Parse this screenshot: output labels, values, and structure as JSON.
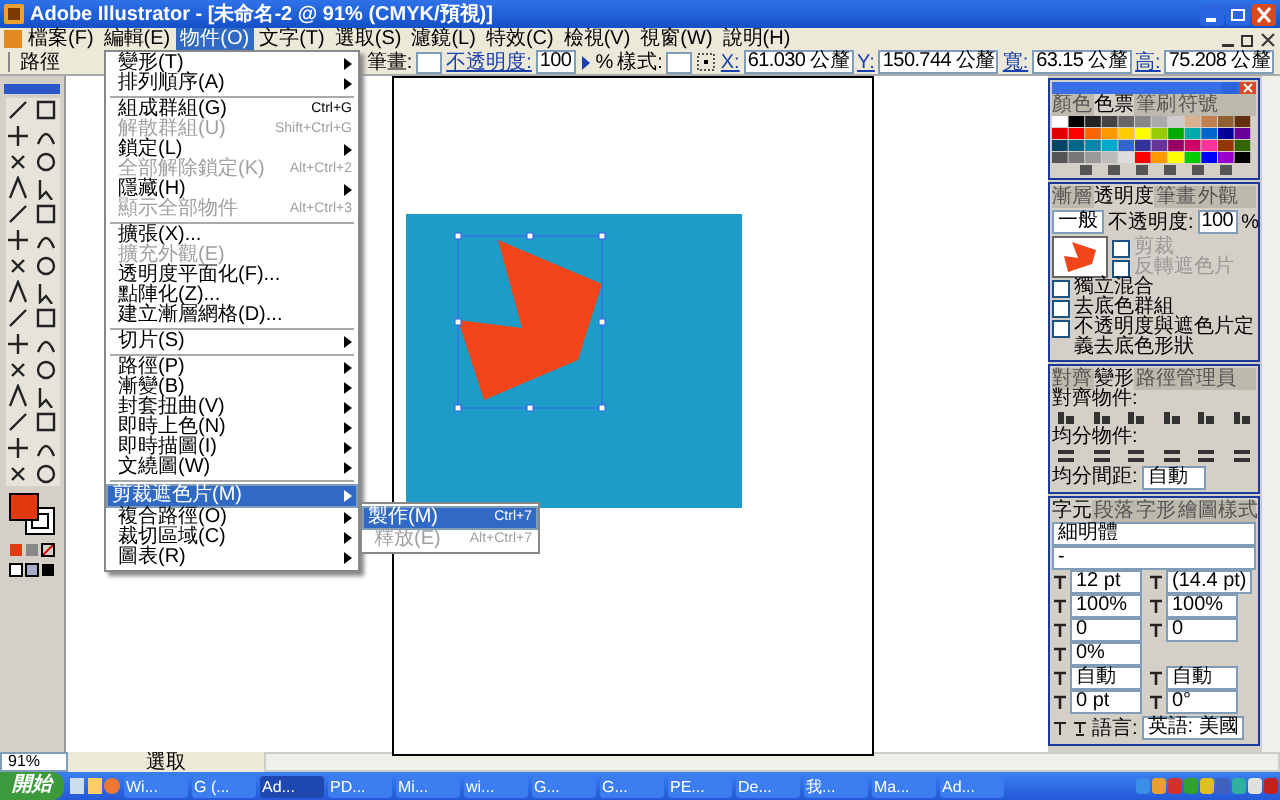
{
  "window": {
    "title": "Adobe Illustrator - [未命名-2 @ 91% (CMYK/預視)]"
  },
  "menu_bar": [
    {
      "label": "檔案(F)",
      "selected": false
    },
    {
      "label": "編輯(E)",
      "selected": false
    },
    {
      "label": "物件(O)",
      "selected": true
    },
    {
      "label": "文字(T)",
      "selected": false
    },
    {
      "label": "選取(S)",
      "selected": false
    },
    {
      "label": "濾鏡(L)",
      "selected": false
    },
    {
      "label": "特效(C)",
      "selected": false
    },
    {
      "label": "檢視(V)",
      "selected": false
    },
    {
      "label": "視窗(W)",
      "selected": false
    },
    {
      "label": "說明(H)",
      "selected": false
    }
  ],
  "control_bar": {
    "object_type": "路徑",
    "stroke_label": "筆畫:",
    "opacity_label": "不透明度:",
    "opacity": "100",
    "percent": "%",
    "style_label": "樣式:",
    "fields": [
      {
        "label": "X:",
        "value": "61.030 公釐"
      },
      {
        "label": "Y:",
        "value": "150.744 公釐"
      },
      {
        "label": "寬:",
        "value": "63.15 公釐"
      },
      {
        "label": "高:",
        "value": "75.208 公釐"
      }
    ]
  },
  "object_menu": {
    "items": [
      {
        "kind": "item",
        "label": "變形(T)",
        "submenu": true,
        "disabled": false,
        "selected": false
      },
      {
        "kind": "item",
        "label": "排列順序(A)",
        "submenu": true,
        "disabled": false,
        "selected": false
      },
      {
        "kind": "separator"
      },
      {
        "kind": "item",
        "label": "組成群組(G)",
        "shortcut": "Ctrl+G",
        "submenu": false,
        "disabled": false,
        "selected": false
      },
      {
        "kind": "item",
        "label": "解散群組(U)",
        "shortcut": "Shift+Ctrl+G",
        "submenu": false,
        "disabled": true,
        "selected": false
      },
      {
        "kind": "item",
        "label": "鎖定(L)",
        "submenu": true,
        "disabled": false,
        "selected": false
      },
      {
        "kind": "item",
        "label": "全部解除鎖定(K)",
        "shortcut": "Alt+Ctrl+2",
        "submenu": false,
        "disabled": true,
        "selected": false
      },
      {
        "kind": "item",
        "label": "隱藏(H)",
        "submenu": true,
        "disabled": false,
        "selected": false
      },
      {
        "kind": "item",
        "label": "顯示全部物件",
        "shortcut": "Alt+Ctrl+3",
        "submenu": false,
        "disabled": true,
        "selected": false
      },
      {
        "kind": "separator"
      },
      {
        "kind": "item",
        "label": "擴張(X)...",
        "submenu": false,
        "disabled": false,
        "selected": false
      },
      {
        "kind": "item",
        "label": "擴充外觀(E)",
        "submenu": false,
        "disabled": true,
        "selected": false
      },
      {
        "kind": "item",
        "label": "透明度平面化(F)...",
        "submenu": false,
        "disabled": false,
        "selected": false
      },
      {
        "kind": "item",
        "label": "點陣化(Z)...",
        "submenu": false,
        "disabled": false,
        "selected": false
      },
      {
        "kind": "item",
        "label": "建立漸層網格(D)...",
        "submenu": false,
        "disabled": false,
        "selected": false
      },
      {
        "kind": "separator"
      },
      {
        "kind": "item",
        "label": "切片(S)",
        "submenu": true,
        "disabled": false,
        "selected": false
      },
      {
        "kind": "separator"
      },
      {
        "kind": "item",
        "label": "路徑(P)",
        "submenu": true,
        "disabled": false,
        "selected": false
      },
      {
        "kind": "item",
        "label": "漸變(B)",
        "submenu": true,
        "disabled": false,
        "selected": false
      },
      {
        "kind": "item",
        "label": "封套扭曲(V)",
        "submenu": true,
        "disabled": false,
        "selected": false
      },
      {
        "kind": "item",
        "label": "即時上色(N)",
        "submenu": true,
        "disabled": false,
        "selected": false
      },
      {
        "kind": "item",
        "label": "即時描圖(I)",
        "submenu": true,
        "disabled": false,
        "selected": false
      },
      {
        "kind": "item",
        "label": "文繞圖(W)",
        "submenu": true,
        "disabled": false,
        "selected": false
      },
      {
        "kind": "separator"
      },
      {
        "kind": "item",
        "label": "剪裁遮色片(M)",
        "submenu": true,
        "disabled": false,
        "selected": true
      },
      {
        "kind": "item",
        "label": "複合路徑(O)",
        "submenu": true,
        "disabled": false,
        "selected": false
      },
      {
        "kind": "item",
        "label": "裁切區域(C)",
        "submenu": true,
        "disabled": false,
        "selected": false
      },
      {
        "kind": "item",
        "label": "圖表(R)",
        "submenu": true,
        "disabled": false,
        "selected": false
      }
    ]
  },
  "submenu": {
    "items": [
      {
        "label": "製作(M)",
        "shortcut": "Ctrl+7",
        "disabled": false,
        "selected": true
      },
      {
        "label": "釋放(E)",
        "shortcut": "Alt+Ctrl+7",
        "disabled": true,
        "selected": false
      }
    ]
  },
  "color_panel": {
    "tabs": [
      {
        "label": "顏色",
        "selected": false
      },
      {
        "label": "色票",
        "selected": true
      },
      {
        "label": "筆刷",
        "selected": false
      },
      {
        "label": "符號",
        "selected": false
      }
    ]
  },
  "transparency_panel": {
    "tabs": [
      {
        "label": "漸層",
        "selected": false
      },
      {
        "label": "透明度",
        "selected": true
      },
      {
        "label": "筆畫",
        "selected": false
      },
      {
        "label": "外觀",
        "selected": false
      }
    ],
    "blend_mode": "一般",
    "opacity_label": "不透明度:",
    "opacity": "100",
    "percent": "%",
    "mask_options": [
      {
        "label": "剪裁",
        "checked": false,
        "disabled": true
      },
      {
        "label": "反轉遮色片",
        "checked": false,
        "disabled": true
      }
    ],
    "options": [
      {
        "label": "獨立混合",
        "checked": false
      },
      {
        "label": "去底色群組",
        "checked": false
      },
      {
        "label": "不透明度與遮色片定義去底色形狀",
        "checked": false
      }
    ]
  },
  "align_panel": {
    "tabs": [
      {
        "label": "對齊",
        "selected": false
      },
      {
        "label": "變形",
        "selected": true
      },
      {
        "label": "路徑管理員",
        "selected": false
      }
    ],
    "align_label": "對齊物件:",
    "distribute_label": "均分物件:",
    "spacing_label": "均分間距:",
    "spacing": "自動"
  },
  "character_panel": {
    "tabs": [
      {
        "label": "字元",
        "selected": true
      },
      {
        "label": "段落",
        "selected": false
      },
      {
        "label": "字形",
        "selected": false
      },
      {
        "label": "繪圖樣式",
        "selected": false
      }
    ],
    "font": "細明體",
    "style": "-",
    "rows": [
      [
        "12 pt",
        "(14.4 pt)"
      ],
      [
        "100%",
        "100%"
      ],
      [
        "0",
        "0"
      ],
      [
        "0%"
      ],
      [
        "自動",
        "自動"
      ],
      [
        "0 pt",
        "0°"
      ]
    ],
    "language_label": "語言:",
    "language": "英語: 美國"
  },
  "status_bar": {
    "zoom": "91%",
    "tool": "選取"
  },
  "taskbar": {
    "start": "開始",
    "tasks": [
      {
        "label": "Wi...",
        "selected": false
      },
      {
        "label": "G (...",
        "selected": false
      },
      {
        "label": "Ad...",
        "selected": true
      },
      {
        "label": "PD...",
        "selected": false
      },
      {
        "label": "Mi...",
        "selected": false
      },
      {
        "label": "wi...",
        "selected": false
      },
      {
        "label": "G...",
        "selected": false
      },
      {
        "label": "G...",
        "selected": false
      },
      {
        "label": "PE...",
        "selected": false
      },
      {
        "label": "De...",
        "selected": false
      },
      {
        "label": "我...",
        "selected": false
      },
      {
        "label": "Ma...",
        "selected": false
      },
      {
        "label": "Ad...",
        "selected": false
      }
    ]
  }
}
